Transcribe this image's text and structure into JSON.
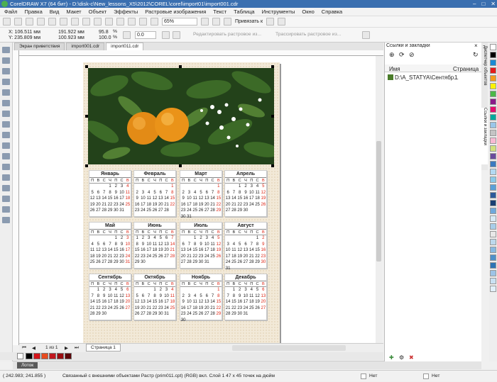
{
  "window": {
    "title": "CorelDRAW X7 (64 бит) - D:\\disk-c\\New_lessons_X5\\2012\\COREL\\corel\\import01\\import001.cdr",
    "controls": [
      "–",
      "□",
      "✕"
    ]
  },
  "menu": [
    "Файл",
    "Правка",
    "Вид",
    "Макет",
    "Объект",
    "Эффекты",
    "Растровые изображения",
    "Текст",
    "Таблица",
    "Инструменты",
    "Окно",
    "Справка"
  ],
  "toolbar1": {
    "zoom": "65%",
    "snap_label": "Привязать к"
  },
  "toolbar2": {
    "x": "X: 106.511 мм",
    "y": "Y: 235.809 мм",
    "w": "191.922 мм",
    "h": "100.923 мм",
    "sx": "95.8",
    "sy": "100.0",
    "pct1": "%",
    "pct2": "%",
    "angle": "0.0",
    "edit_bitmap": "Редактировать растровое из...",
    "trace_bitmap": "Трассировать растровое из..."
  },
  "tabs": [
    "Экран приветствия",
    "import001.cdr",
    "import011.cdr"
  ],
  "calendar": {
    "dow": [
      "П",
      "В",
      "С",
      "Ч",
      "П",
      "С",
      "В"
    ],
    "months": [
      {
        "name": "Январь",
        "offset": 3,
        "days": 31
      },
      {
        "name": "Февраль",
        "offset": 6,
        "days": 28
      },
      {
        "name": "Март",
        "offset": 6,
        "days": 31
      },
      {
        "name": "Апрель",
        "offset": 2,
        "days": 30
      },
      {
        "name": "Май",
        "offset": 4,
        "days": 31
      },
      {
        "name": "Июнь",
        "offset": 0,
        "days": 30
      },
      {
        "name": "Июль",
        "offset": 2,
        "days": 31
      },
      {
        "name": "Август",
        "offset": 5,
        "days": 31
      },
      {
        "name": "Сентябрь",
        "offset": 1,
        "days": 30
      },
      {
        "name": "Октябрь",
        "offset": 3,
        "days": 31
      },
      {
        "name": "Ноябрь",
        "offset": 6,
        "days": 30
      },
      {
        "name": "Декабрь",
        "offset": 1,
        "days": 31
      }
    ]
  },
  "pager": {
    "info": "1 из 1",
    "page_tab": "Страница 1"
  },
  "docker": {
    "title": "Ссылки и закладки",
    "col_name": "Имя",
    "col_page": "Страница",
    "row_name": "D:\\A_STATYA\\Сентябр...",
    "row_page": "1"
  },
  "docker_tabs": [
    "Диспетчер объектов",
    "Ссылки и закладки"
  ],
  "lotok": "Лоток",
  "status": {
    "coords": "( 242.983; 241.855 )",
    "text": "Связанный с внешними объектами Растр (prim011.cpt) (RGB) вкл. Слой 1 47 x 45 точек на дюйм",
    "fill": "Нет",
    "outline": "Нет"
  },
  "colors": [
    "#ffffff",
    "#000000",
    "#1a8ad4",
    "#e41b1b",
    "#f29a1e",
    "#fff200",
    "#4cb848",
    "#8b1a89",
    "#e60d6d",
    "#00a99d",
    "#9ac6e9",
    "#c4c4c4",
    "#f7b9d2",
    "#d1e17c",
    "#6a4c9c",
    "#3b7ac0",
    "#b3d9f2",
    "#8bc9e8",
    "#5aa0d8",
    "#2d5a9b",
    "#1a3f73",
    "#6fa8dc",
    "#d8eaf6",
    "#a8cde9",
    "#e8e8e8",
    "#bcd8ec",
    "#88b8e0",
    "#4f8fc9",
    "#2f74b5",
    "#9dc3e6",
    "#c9e1f3",
    "#e2f0fa"
  ],
  "palette_colors": [
    "#000000",
    "#d4141a",
    "#e74a1e",
    "#c1171e",
    "#9a0c10",
    "#5c0609"
  ]
}
